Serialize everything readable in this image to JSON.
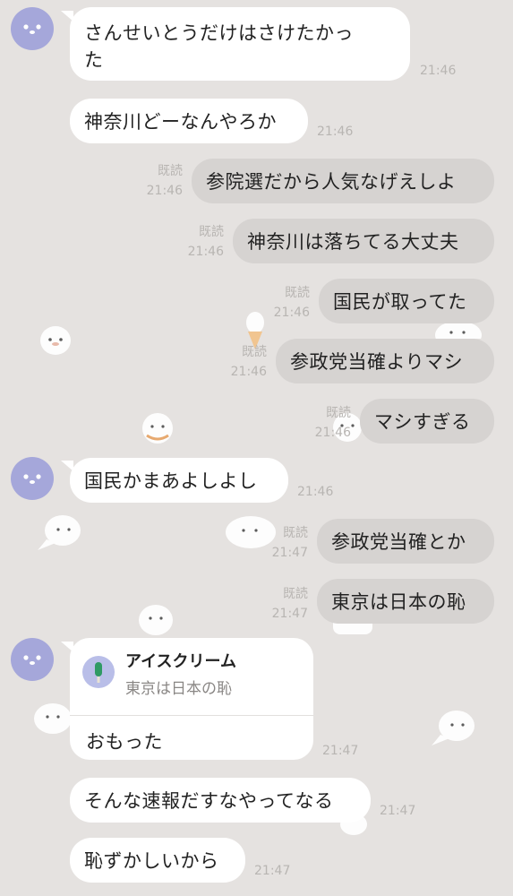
{
  "messages": [
    {
      "side": "in",
      "text": "さんせいとうだけはさけたかった",
      "line1": "さんせいとうだけはさけたかっ",
      "line2": "た",
      "time": "21:46"
    },
    {
      "side": "in",
      "text": "神奈川どーなんやろか",
      "time": "21:46"
    },
    {
      "side": "out",
      "text": "参院選だから人気なげえしよ",
      "read": "既読",
      "time": "21:46"
    },
    {
      "side": "out",
      "text": "神奈川は落ちてる大丈夫",
      "read": "既読",
      "time": "21:46"
    },
    {
      "side": "out",
      "text": "国民が取ってた",
      "read": "既読",
      "time": "21:46"
    },
    {
      "side": "out",
      "text": "参政党当確よりマシ",
      "read": "既読",
      "time": "21:46"
    },
    {
      "side": "out",
      "text": "マシすぎる",
      "read": "既読",
      "time": "21:46"
    },
    {
      "side": "in",
      "text": "国民かまあよしよし",
      "time": "21:46"
    },
    {
      "side": "out",
      "text": "参政党当確とか",
      "read": "既読",
      "time": "21:47"
    },
    {
      "side": "out",
      "text": "東京は日本の恥",
      "read": "既読",
      "time": "21:47"
    },
    {
      "side": "in",
      "reply_name": "アイスクリーム",
      "reply_quote": "東京は日本の恥",
      "text": "おもった",
      "time": "21:47"
    },
    {
      "side": "in",
      "text": "そんな速報だすなやってなる",
      "time": "21:47"
    },
    {
      "side": "in",
      "text": "恥ずかしいから",
      "time": "21:47"
    }
  ],
  "icons": {
    "avatar": "seal-avatar-icon",
    "reply_thumb": "green-ice-cream-icon",
    "background": "seal-stamp-pattern"
  },
  "colors": {
    "background": "#e5e2e0",
    "bubble_in": "#ffffff",
    "bubble_out": "#d6d3d1",
    "avatar": "#a5a7da",
    "meta_text": "#b8b5b2"
  }
}
